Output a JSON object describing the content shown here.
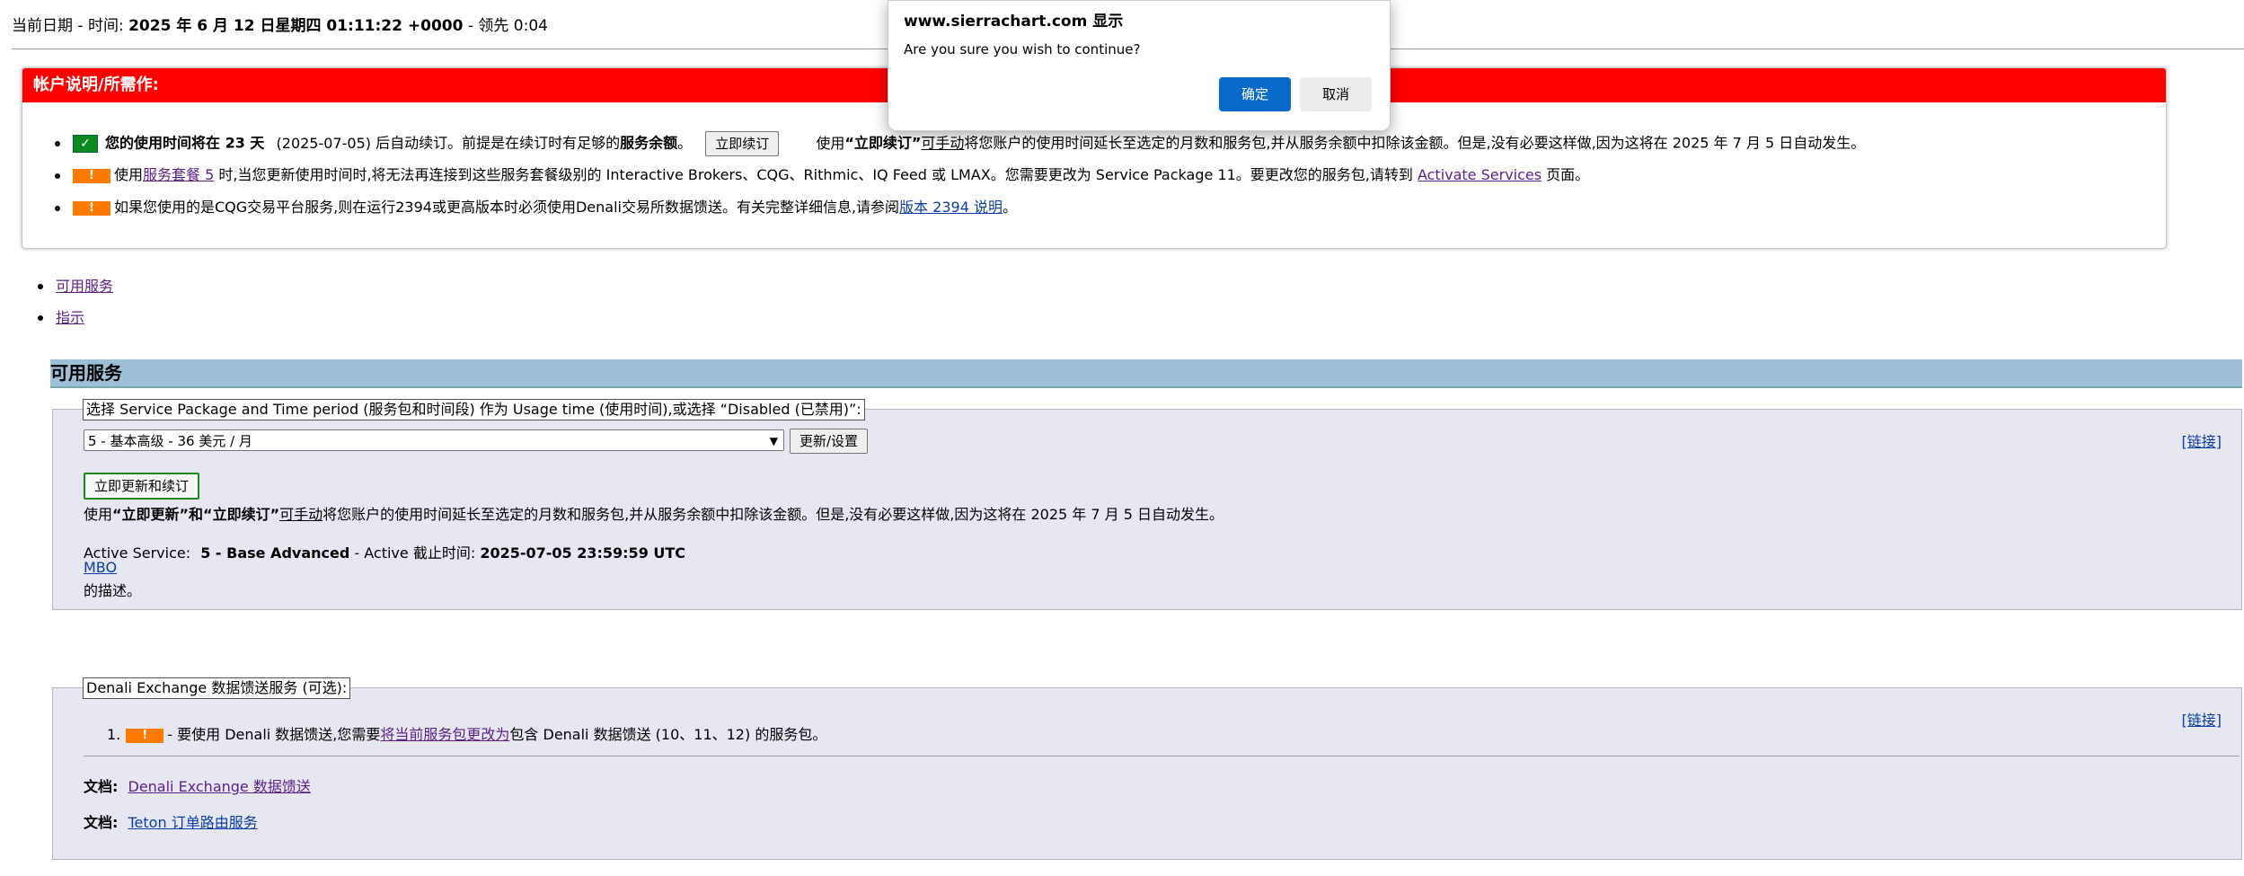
{
  "topline": {
    "date_label": "当前日期 - 时间:",
    "date_value": "2025 年 6 月 12 日星期四 01:11:22 +0000",
    "sep": "- 领先",
    "lead": "0:04"
  },
  "account": {
    "title": "帐户说明/所需作:",
    "item1": {
      "bold_text": "您的使用时间将在 23 天",
      "date_text": "(2025-07-05)",
      "text_a": " 后自动续订。前提是在续订时有足够的",
      "bold_balance": "服务余额",
      "text_b": "。",
      "renew_button": "立即续订",
      "text_c": "使用",
      "bold_quote": "“立即续订”",
      "manual": "可手动",
      "text_d": "将您账户的使用时间延长至选定的月数和服务包,并从服务余额中扣除该金额。但是,没有必要这样做,因为这将在 2025 年 7 月 5 日自动发生。"
    },
    "item2": {
      "badge": "!",
      "text_a": "使用",
      "link_pkg": "服务套餐 5",
      "text_b": " 时,当您更新使用时间时,将无法再连接到这些服务套餐级别的 Interactive Brokers、CQG、Rithmic、IQ Feed 或 LMAX。您需要更改为 Service Package 11。要更改您的服务包,请转到 ",
      "link_activate": "Activate Services",
      "text_c": " 页面。"
    },
    "item3": {
      "badge": "!",
      "text_a": "如果您使用的是CQG交易平台服务,则在运行2394或更高版本时必须使用Denali交易所数据馈送。有关完整详细信息,请参阅",
      "link_version": "版本 2394 说明",
      "text_b": "。"
    }
  },
  "nav": {
    "item1": "可用服务",
    "item2": "指示"
  },
  "section": {
    "title": "可用服务"
  },
  "panel1": {
    "legend": "选择 Service Package and Time period (服务包和时间段) 作为 Usage time (使用时间),或选择 “Disabled (已禁用)”:",
    "link_ref": "[链接]",
    "select_value": "5 - 基本高级 - 36 美元 / 月",
    "update_button": "更新/设置",
    "renew_button": "立即更新和续订",
    "desc_a": "使用",
    "desc_bold": "“立即更新”和“立即续订”",
    "desc_manual": "可手动",
    "desc_b": "将您账户的使用时间延长至选定的月数和服务包,并从服务余额中扣除该金额。但是,没有必要这样做,因为这将在 2025 年 7 月 5 日自动发生。",
    "active_label": "Active Service:",
    "active_value": "5 - Base Advanced",
    "active_sep": " - Active 截止时间:",
    "active_until": "2025-07-05 23:59:59 UTC",
    "mbo_link": "MBO",
    "mbo_desc": "的描述。"
  },
  "panel2": {
    "legend": "Denali Exchange 数据馈送服务 (可选):",
    "link_ref": "[链接]",
    "item_num": "1.",
    "item_badge": "!",
    "item_a": "- 要使用 Denali 数据馈送,您需要",
    "item_link": "将当前服务包更改为",
    "item_b": "包含 Denali 数据馈送 (10、11、12) 的服务包。",
    "doc_label1": "文档:",
    "doc_link1": "Denali Exchange 数据馈送",
    "doc_label2": "文档:",
    "doc_link2": "Teton 订单路由服务"
  },
  "dialog": {
    "title": "www.sierrachart.com 显示",
    "message": "Are you sure you wish to continue?",
    "ok": "确定",
    "cancel": "取消"
  }
}
